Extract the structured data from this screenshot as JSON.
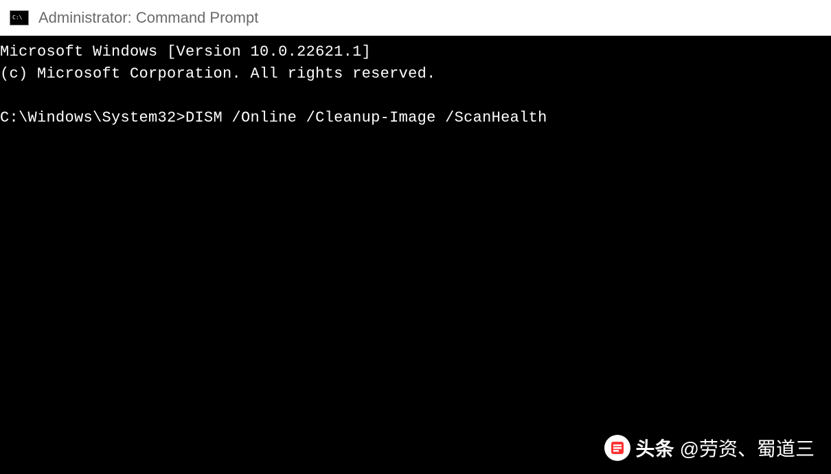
{
  "titlebar": {
    "title": "Administrator: Command Prompt"
  },
  "terminal": {
    "line1": "Microsoft Windows [Version 10.0.22621.1]",
    "line2": "(c) Microsoft Corporation. All rights reserved.",
    "prompt": "C:\\Windows\\System32>",
    "command": "DISM /Online /Cleanup-Image /ScanHealth"
  },
  "watermark": {
    "brand": "头条",
    "user": "@劳资、蜀道三"
  }
}
